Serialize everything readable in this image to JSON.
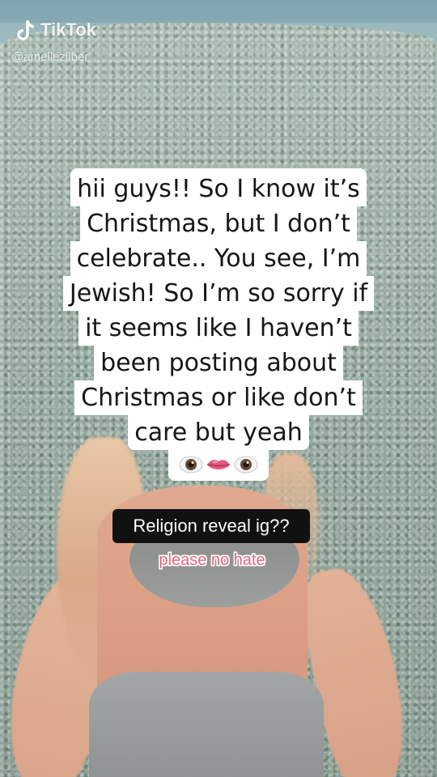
{
  "watermark": {
    "brand": "TikTok",
    "handle": "@amellezilber",
    "logo_icon": "tiktok-logo-icon"
  },
  "caption": {
    "lines": [
      "hii guys!! So I know it’s",
      "Christmas, but I don’t",
      "celebrate.. You see, I’m",
      "Jewish! So I’m so sorry if",
      "it seems like I haven’t",
      "been posting about",
      "Christmas or like don’t",
      "care but yeah"
    ],
    "emojis": [
      "eye-emoji",
      "lips-emoji",
      "eye-emoji"
    ]
  },
  "labels": {
    "question": "Religion reveal ig??",
    "plea": "please no hate"
  },
  "colors": {
    "caption_bg": "#ffffff",
    "question_bg": "#111111",
    "plea_text": "#e8647f"
  }
}
